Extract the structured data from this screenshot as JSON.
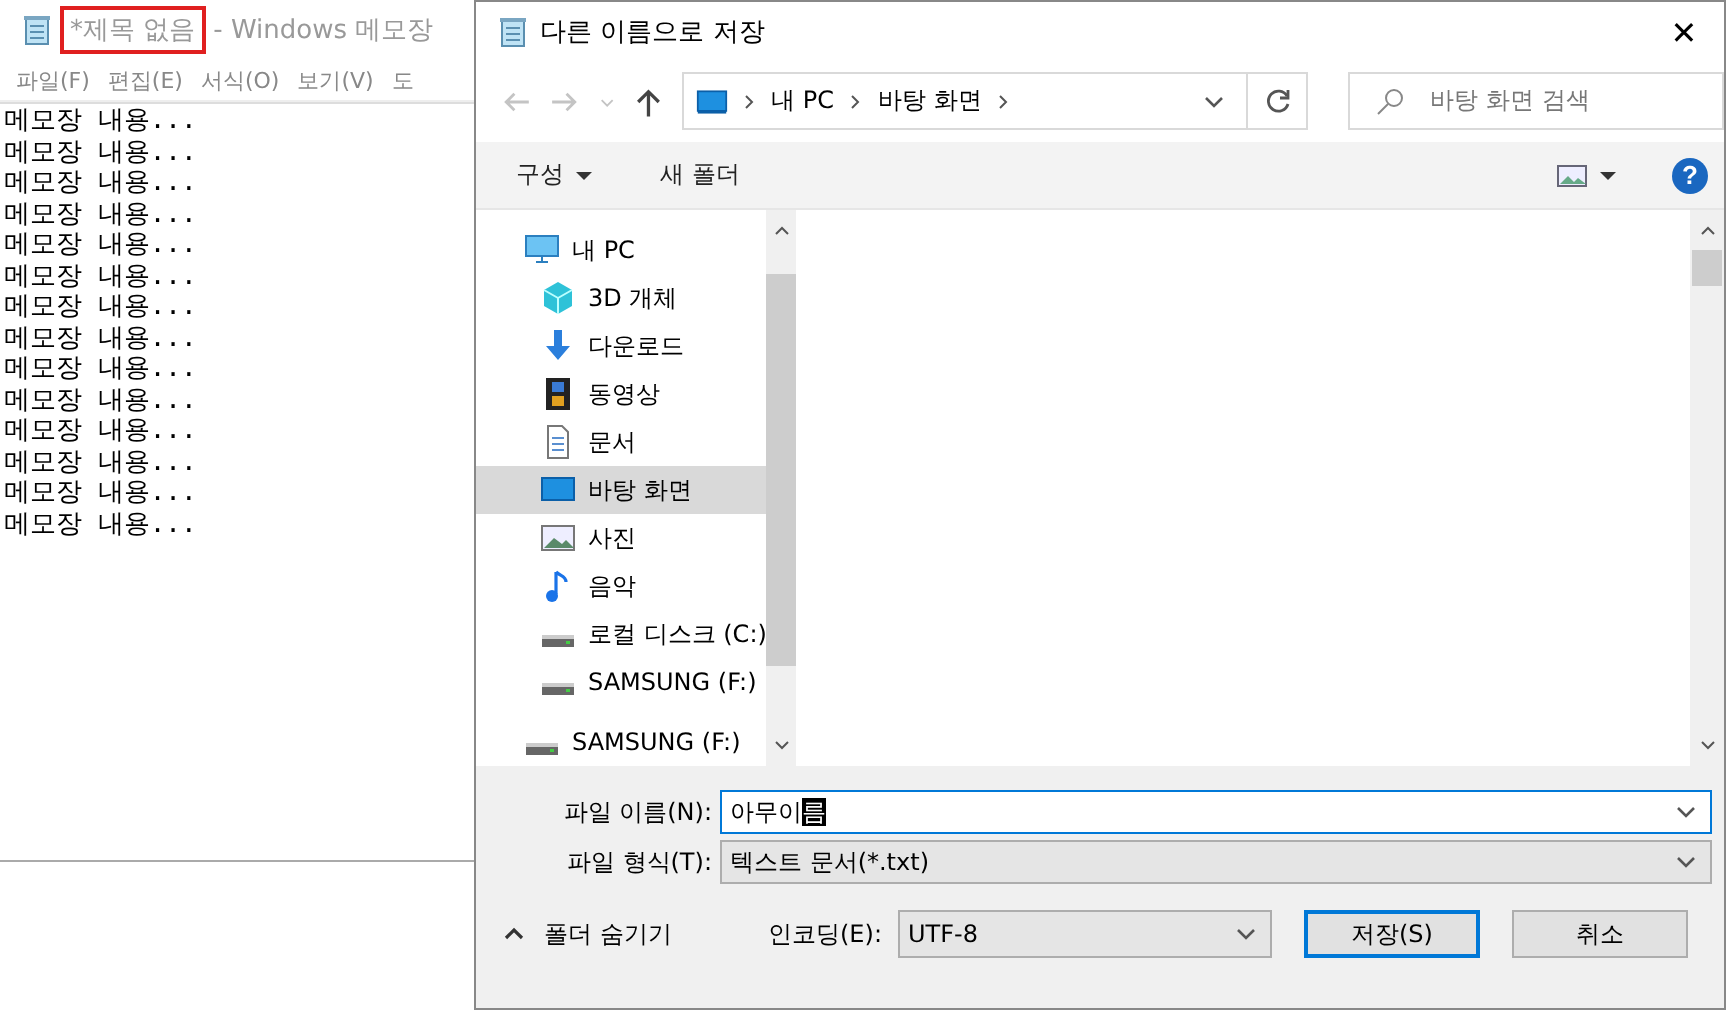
{
  "notepad": {
    "title_marked": "*제목 없음",
    "title_rest": "- Windows 메모장",
    "menu": [
      "파일(F)",
      "편집(E)",
      "서식(O)",
      "보기(V)",
      "도"
    ],
    "lines": [
      "메모장 내용...",
      "메모장 내용...",
      "메모장 내용...",
      "메모장 내용...",
      "메모장 내용...",
      "메모장 내용...",
      "메모장 내용...",
      "메모장 내용...",
      "메모장 내용...",
      "메모장 내용...",
      "메모장 내용...",
      "메모장 내용...",
      "메모장 내용...",
      "메모장 내용..."
    ]
  },
  "dialog": {
    "title": "다른 이름으로 저장",
    "close": "✕",
    "breadcrumb": [
      "내 PC",
      "바탕 화면"
    ],
    "search": {
      "placeholder": "바탕 화면 검색"
    },
    "toolbar": {
      "organize": "구성",
      "new_folder": "새 폴더",
      "help": "?"
    },
    "tree": [
      {
        "label": "내 PC",
        "kind": "pc",
        "selected": false,
        "children": [
          {
            "label": "3D 개체",
            "kind": "cube",
            "selected": false
          },
          {
            "label": "다운로드",
            "kind": "download",
            "selected": false
          },
          {
            "label": "동영상",
            "kind": "film",
            "selected": false
          },
          {
            "label": "문서",
            "kind": "doc",
            "selected": false
          },
          {
            "label": "바탕 화면",
            "kind": "desktop",
            "selected": true
          },
          {
            "label": "사진",
            "kind": "photo",
            "selected": false
          },
          {
            "label": "음악",
            "kind": "music",
            "selected": false
          },
          {
            "label": "로컬 디스크 (C:)",
            "kind": "drive",
            "selected": false
          },
          {
            "label": "SAMSUNG (F:)",
            "kind": "drive",
            "selected": false
          }
        ]
      },
      {
        "label": "SAMSUNG (F:)",
        "kind": "drive",
        "selected": false
      }
    ],
    "filename": {
      "label": "파일 이름(N):",
      "value": "아무이",
      "composing": "름"
    },
    "filetype": {
      "label": "파일 형식(T):",
      "value": "텍스트 문서(*.txt)"
    },
    "hide_folders": "폴더 숨기기",
    "encoding": {
      "label": "인코딩(E):",
      "value": "UTF-8"
    },
    "buttons": [
      {
        "label": "저장(S)",
        "default": true
      },
      {
        "label": "취소",
        "default": false
      }
    ]
  }
}
